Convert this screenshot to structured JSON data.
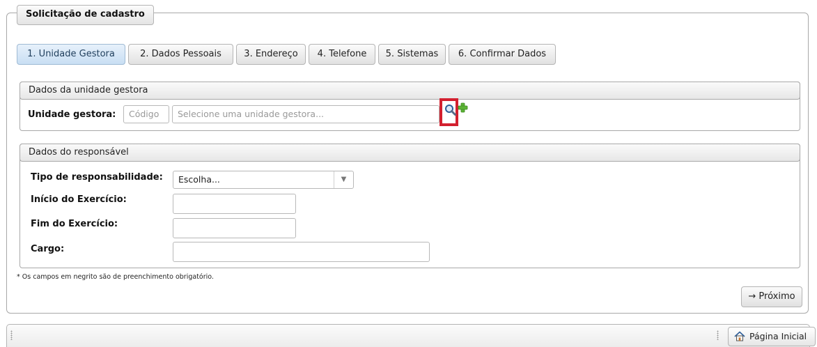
{
  "form": {
    "legend": "Solicitação de cadastro",
    "tabs": [
      {
        "label": "1. Unidade Gestora",
        "active": true
      },
      {
        "label": "2. Dados Pessoais",
        "active": false
      },
      {
        "label": "3. Endereço",
        "active": false
      },
      {
        "label": "4. Telefone",
        "active": false
      },
      {
        "label": "5. Sistemas",
        "active": false
      },
      {
        "label": "6. Confirmar Dados",
        "active": false
      }
    ],
    "unidade_panel": {
      "title": "Dados da unidade gestora",
      "field_label": "Unidade gestora:",
      "code_placeholder": "Código",
      "name_placeholder": "Selecione uma unidade gestora...",
      "search_icon": "magnifier-icon",
      "add_icon": "green-plus-icon",
      "highlight_color": "#d3202f"
    },
    "responsavel_panel": {
      "title": "Dados do responsável",
      "tipo_label": "Tipo de responsabilidade:",
      "tipo_selected": "Escolha...",
      "inicio_label": "Início do Exercício:",
      "inicio_value": "",
      "fim_label": "Fim do Exercício:",
      "fim_value": "",
      "cargo_label": "Cargo:",
      "cargo_value": ""
    },
    "required_note": "* Os campos em negrito são de preenchimento obrigatório.",
    "next_label": "→ Próximo"
  },
  "footer": {
    "home_label": "Página Inicial",
    "home_icon": "house-icon"
  }
}
